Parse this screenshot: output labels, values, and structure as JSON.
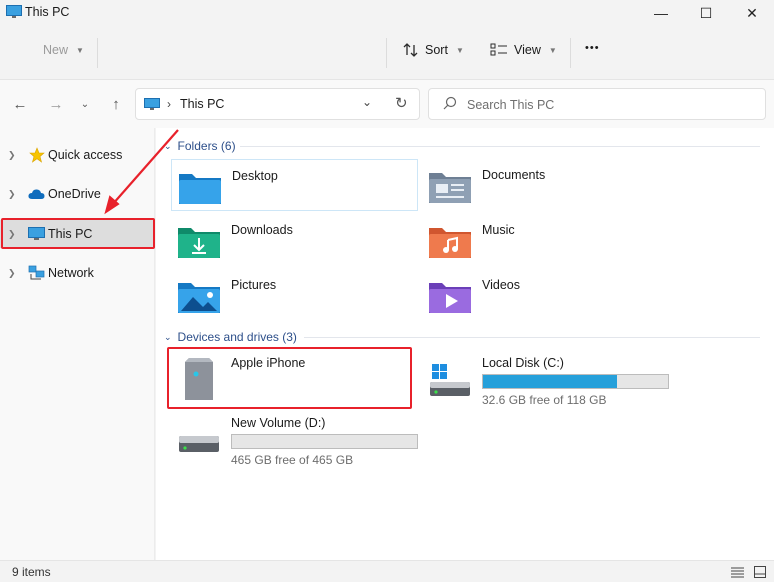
{
  "window": {
    "title": "This PC",
    "minimize_glyph": "—",
    "maximize_glyph": "☐",
    "close_glyph": "✕"
  },
  "toolbar": {
    "new_label": "New",
    "sort_label": "Sort",
    "view_label": "View",
    "more_glyph": "•••"
  },
  "address_bar": {
    "crumb": "This PC"
  },
  "search": {
    "placeholder": "Search This PC"
  },
  "sidebar": {
    "items": [
      {
        "label": "Quick access",
        "icon": "star-icon"
      },
      {
        "label": "OneDrive",
        "icon": "cloud-icon"
      },
      {
        "label": "This PC",
        "icon": "computer-icon",
        "selected": true
      },
      {
        "label": "Network",
        "icon": "network-icon"
      }
    ]
  },
  "folders_group": {
    "header": "Folders (6)",
    "items": [
      {
        "name": "Desktop",
        "icon": "desktop-folder-icon"
      },
      {
        "name": "Documents",
        "icon": "documents-folder-icon"
      },
      {
        "name": "Downloads",
        "icon": "downloads-folder-icon"
      },
      {
        "name": "Music",
        "icon": "music-folder-icon"
      },
      {
        "name": "Pictures",
        "icon": "pictures-folder-icon"
      },
      {
        "name": "Videos",
        "icon": "videos-folder-icon"
      }
    ]
  },
  "devices_group": {
    "header": "Devices and drives (3)",
    "items": [
      {
        "name": "Apple iPhone",
        "icon": "phone-device-icon"
      },
      {
        "name": "Local Disk (C:)",
        "icon": "windows-drive-icon",
        "free_text": "32.6 GB free of 118 GB",
        "used_fraction": 0.724
      },
      {
        "name": "New Volume (D:)",
        "icon": "hard-drive-icon",
        "free_text": "465 GB free of 465 GB",
        "used_fraction": 0.0
      }
    ]
  },
  "status_bar": {
    "item_count": "9 items"
  },
  "colors": {
    "accent": "#26a0da",
    "highlight_red": "#e8212b",
    "group_header": "#2d4f8a"
  }
}
